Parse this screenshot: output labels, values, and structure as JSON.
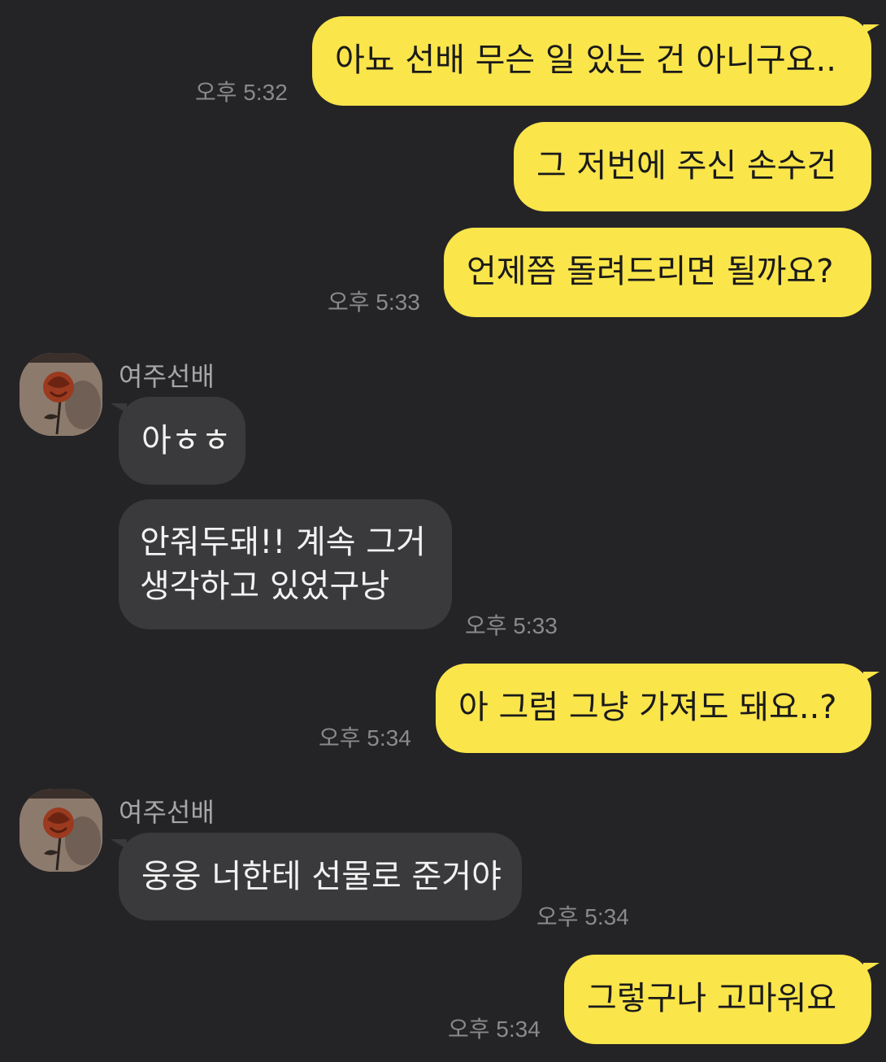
{
  "chat": {
    "sender_name": "여주선배",
    "messages": [
      {
        "dir": "out",
        "text": "아뇨 선배 무슨 일 있는 건 아니구요..",
        "time": "오후 5:32"
      },
      {
        "dir": "out",
        "text": "그 저번에 주신 손수건",
        "time": ""
      },
      {
        "dir": "out",
        "text": "언제쯤 돌려드리면 될까요?",
        "time": "오후 5:33"
      },
      {
        "dir": "in",
        "text": "아ㅎㅎ",
        "time": ""
      },
      {
        "dir": "in",
        "lines": [
          "안줘두돼!! 계속 그거",
          "생각하고 있었구낭"
        ],
        "time": "오후 5:33"
      },
      {
        "dir": "out",
        "text": "아 그럼 그냥 가져도 돼요..?",
        "time": "오후 5:34"
      },
      {
        "dir": "in",
        "text": "웅웅 너한테 선물로 준거야",
        "time": "오후 5:34"
      },
      {
        "dir": "out",
        "text": "그렇구나 고마워요",
        "time": "오후 5:34"
      }
    ]
  },
  "colors": {
    "background": "#242426",
    "outgoing_bubble": "#FAE54B",
    "incoming_bubble": "#3A3A3C",
    "timestamp": "#8a8a8c"
  },
  "icons": {
    "avatar": "rose-profile-photo"
  }
}
